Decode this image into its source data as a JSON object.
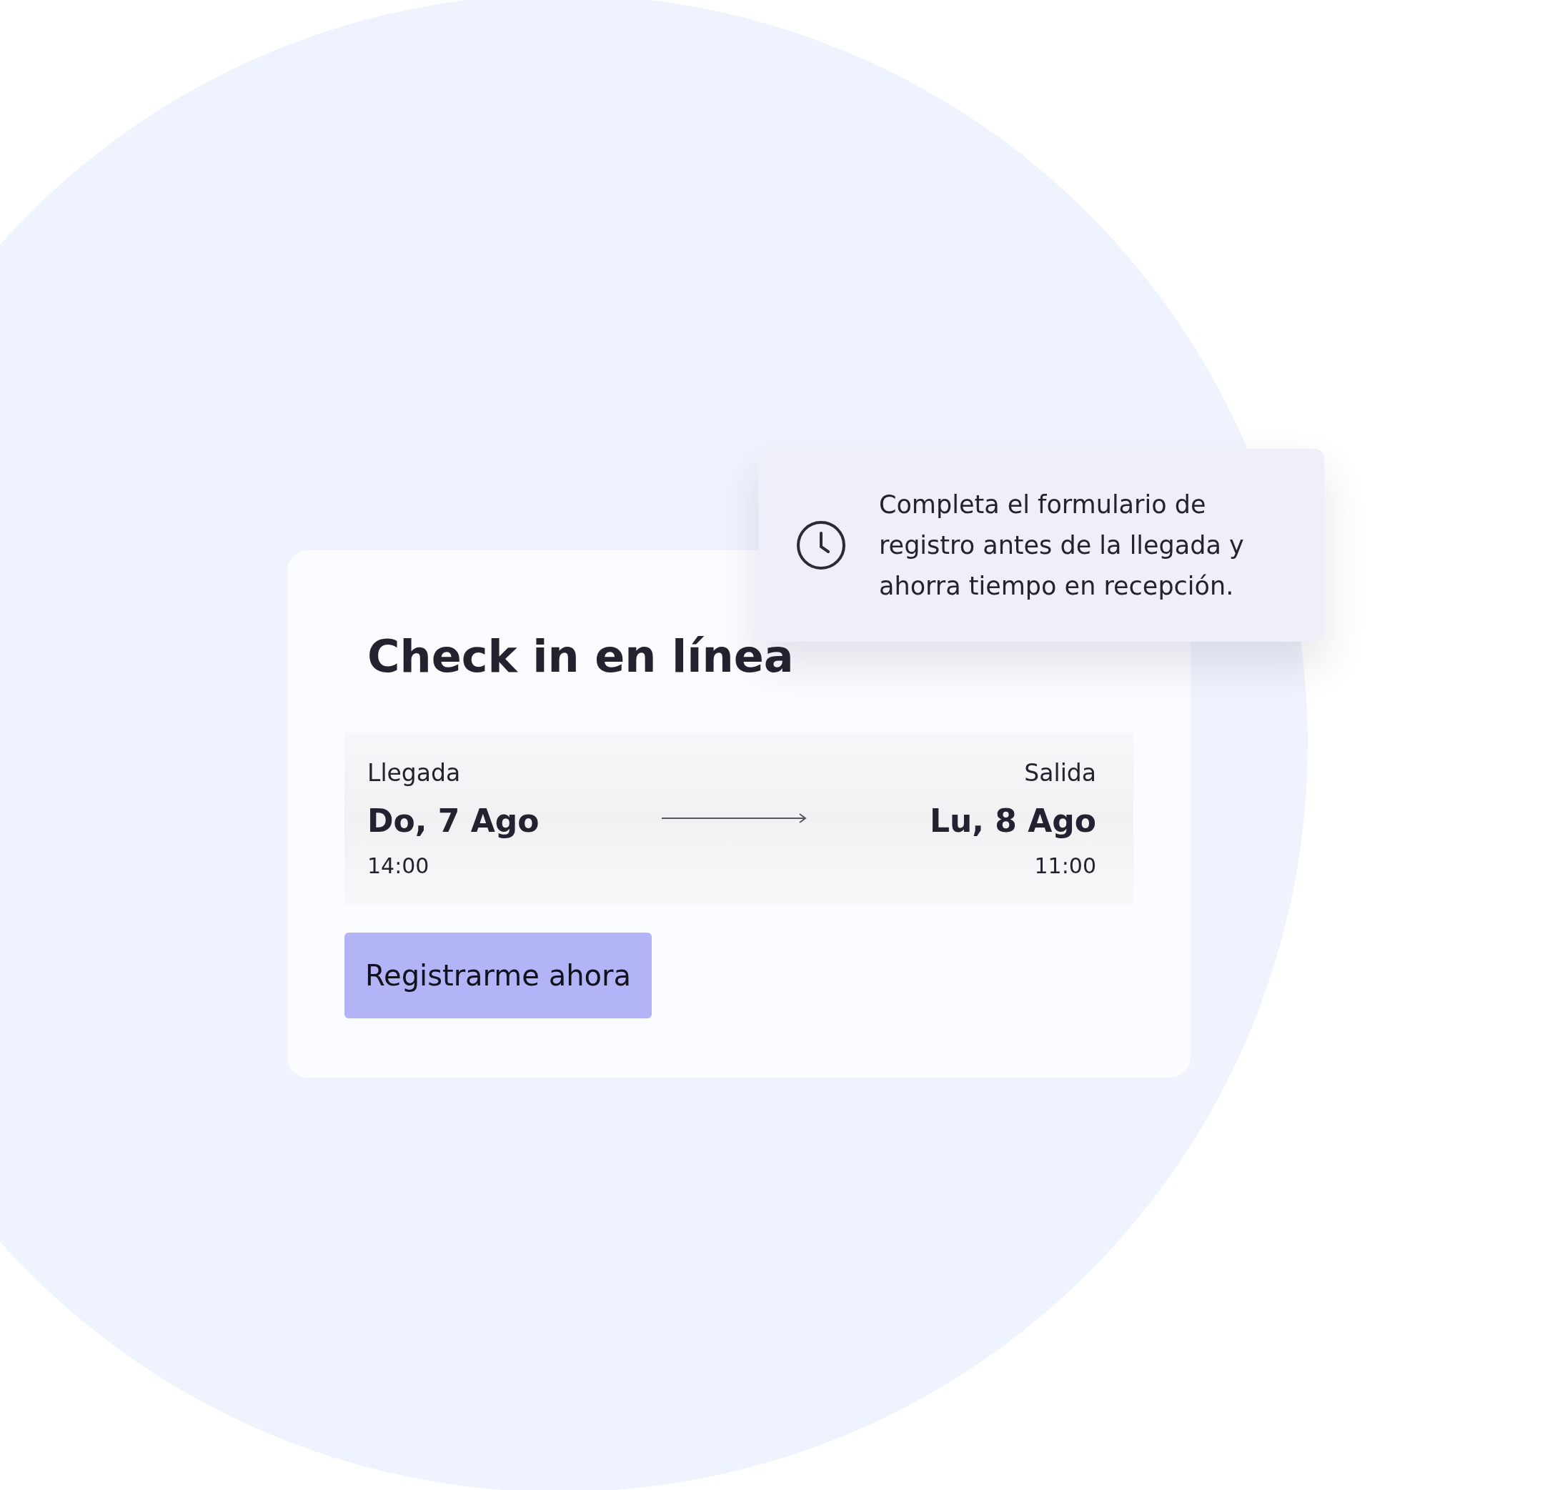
{
  "title": "Check in en línea",
  "stays": [
    {
      "kind": "arrival",
      "label": "Llegada",
      "date": "Do, 7 Ago",
      "time": "14:00"
    },
    {
      "kind": "departure",
      "label": "Salida",
      "date": "Lu, 8 Ago",
      "time": "11:00"
    }
  ],
  "button": "Registrarme ahora",
  "notice": {
    "text": "Completa el formulario de registro antes de la llegada y ahorra tiempo en recepción."
  }
}
